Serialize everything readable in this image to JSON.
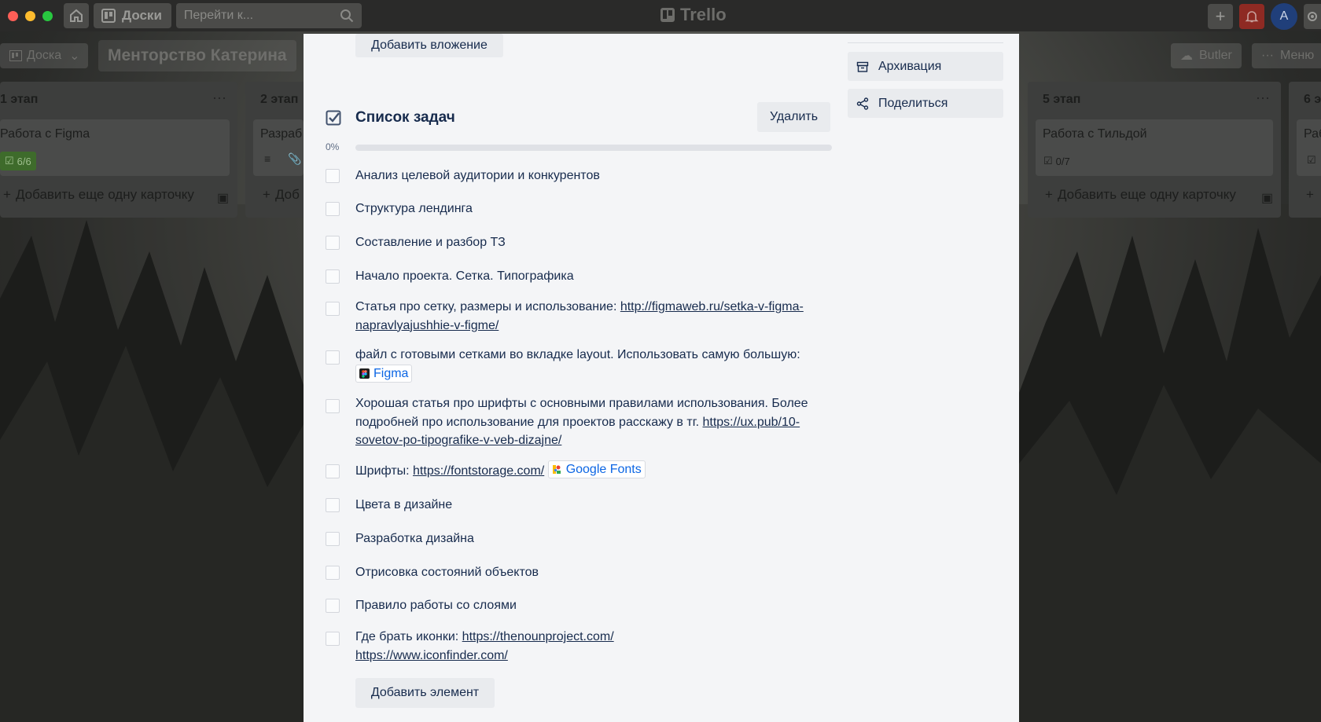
{
  "topbar": {
    "traffic_colors": [
      "#fe5f57",
      "#febc2e",
      "#28c840"
    ],
    "boards_label": "Доски",
    "search_placeholder": "Перейти к...",
    "logo_label": "Trello",
    "avatar_initial": "A"
  },
  "board": {
    "view_label": "Доска",
    "title": "Менторство Катерина",
    "butler_label": "Butler",
    "menu_label": "Меню"
  },
  "lists": [
    {
      "title": "1 этап",
      "card_title": "Работа с Figma",
      "badge": "6/6",
      "add_label": "Добавить еще одну карточку"
    },
    {
      "title": "2 этап",
      "card_title": "Разраб",
      "add_label": "Доб"
    },
    {
      "title": "5 этап",
      "card_title": "Работа с Тильдой",
      "badge": "0/7",
      "add_label": "Добавить еще одну карточку"
    },
    {
      "title": "6 э",
      "card_title": "Раб"
    }
  ],
  "modal": {
    "add_attachment_label": "Добавить вложение",
    "checklist_title": "Список задач",
    "delete_label": "Удалить",
    "progress_label": "0%",
    "progress_value": 0,
    "add_item_label": "Добавить элемент",
    "sidebar": {
      "archive_label": "Архивация",
      "share_label": "Поделиться"
    },
    "items": [
      {
        "text": "Анализ целевой аудитории и конкурентов"
      },
      {
        "text": "Структура лендинга"
      },
      {
        "text": "Составление и разбор ТЗ"
      },
      {
        "text": "Начало проекта. Сетка. Типографика"
      },
      {
        "text": "Статья про сетку, размеры и использование: ",
        "link": "http://figmaweb.ru/setka-v-figma-napravlyajushhie-v-figme/"
      },
      {
        "text": "файл с готовыми сетками во вкладке layout. Использовать самую большую: ",
        "chip": "Figma"
      },
      {
        "text": "Хорошая статья про шрифты с основными правилами использования. Более подробней про использование для проектов расскажу в тг. ",
        "link": "https://ux.pub/10-sovetov-po-tipografike-v-veb-dizajne/"
      },
      {
        "text": "Шрифты: ",
        "link": "https://fontstorage.com/",
        "chip": "Google Fonts"
      },
      {
        "text": "Цвета в дизайне"
      },
      {
        "text": "Разработка дизайна"
      },
      {
        "text": "Отрисовка состояний объектов"
      },
      {
        "text": "Правило работы со слоями"
      },
      {
        "text": "Где брать иконки: ",
        "link": "https://thenounproject.com/",
        "link2": "https://www.iconfinder.com/"
      }
    ]
  }
}
